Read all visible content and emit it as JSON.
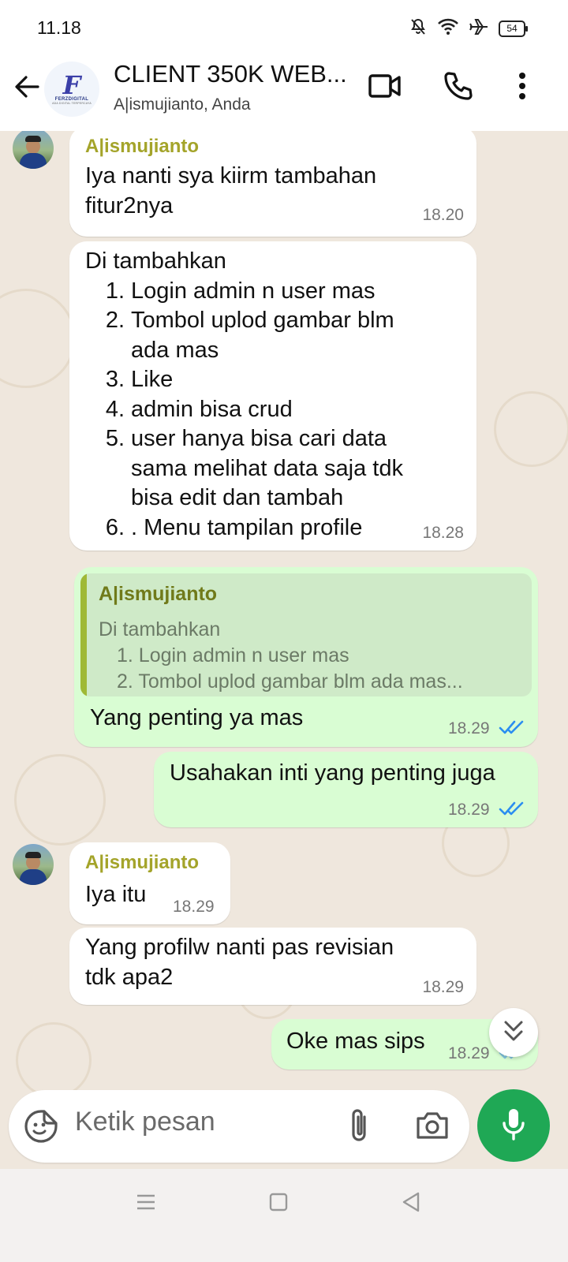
{
  "status_bar": {
    "time": "11.18",
    "battery": "54",
    "icons": [
      "mute-icon",
      "wifi-icon",
      "airplane-icon",
      "battery-icon"
    ]
  },
  "header": {
    "title": "CLIENT 350K WEB...",
    "subtitle": "A|ismujianto, Anda",
    "avatar_logo": {
      "letter": "F",
      "name": "FERZDIGITAL",
      "tagline": "ADA DIGITAL TERPERCAYA"
    },
    "icons": [
      "back-arrow-icon",
      "video-call-icon",
      "phone-call-icon",
      "more-options-icon"
    ]
  },
  "messages": [
    {
      "sender": "A|ismujianto",
      "text_lines": [
        "Iya nanti sya kiirm tambahan",
        "fitur2nya"
      ],
      "time": "18.20"
    },
    {
      "intro": "Di tambahkan",
      "items": [
        {
          "num": "1.",
          "lines": [
            "Login admin n user mas"
          ]
        },
        {
          "num": "2.",
          "lines": [
            "Tombol uplod gambar blm",
            "ada mas"
          ]
        },
        {
          "num": "3.",
          "lines": [
            "Like"
          ]
        },
        {
          "num": "4.",
          "lines": [
            "admin bisa crud"
          ]
        },
        {
          "num": "5.",
          "lines": [
            "user hanya bisa cari data",
            "sama melihat data saja tdk",
            "bisa edit dan tambah"
          ]
        },
        {
          "num": "6.",
          "lines": [
            ". Menu tampilan profile"
          ]
        }
      ],
      "time": "18.28"
    },
    {
      "quote": {
        "sender": "A|ismujianto",
        "lines": [
          "Di tambahkan",
          "1. Login admin n user mas",
          "2. Tombol uplod gambar blm ada mas..."
        ]
      },
      "text": "Yang penting ya mas",
      "time": "18.29"
    },
    {
      "text": "Usahakan inti yang penting juga",
      "time": "18.29"
    },
    {
      "sender": "A|ismujianto",
      "text": "Iya itu",
      "time": "18.29"
    },
    {
      "text_lines": [
        "Yang profilw nanti pas revisian",
        "tdk apa2"
      ],
      "time": "18.29"
    },
    {
      "text": "Oke mas sips",
      "time": "18.29"
    }
  ],
  "composer": {
    "placeholder": "Ketik pesan",
    "icons": [
      "sticker-icon",
      "attachment-icon",
      "camera-icon",
      "microphone-icon"
    ]
  },
  "navbar": {
    "icons": [
      "menu-nav-icon",
      "home-nav-icon",
      "back-nav-icon"
    ]
  },
  "colors": {
    "accent_green": "#1fa855",
    "outgoing_bubble": "#d9fdd3",
    "incoming_bubble": "#ffffff",
    "chat_background": "#efe7dd",
    "sender_name": "#a4a42a",
    "read_ticks": "#2b8ef0"
  }
}
